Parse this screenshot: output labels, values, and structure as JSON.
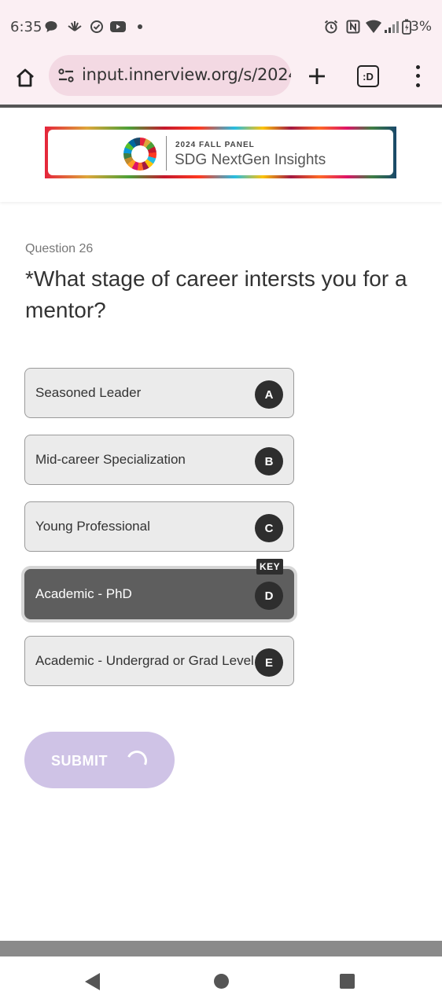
{
  "status_bar": {
    "time": "6:35",
    "battery": "3%",
    "icons": [
      "chat-icon",
      "pinwheel-icon",
      "check-circle-icon",
      "youtube-icon",
      "dot-icon",
      "alarm-icon",
      "nfc-icon",
      "wifi-icon",
      "signal-icon",
      "battery-icon"
    ]
  },
  "browser": {
    "url": "input.innerview.org/s/2024-",
    "tab_count": ":D"
  },
  "header": {
    "banner_small": "2024 FALL PANEL",
    "banner_big": "SDG NextGen Insights"
  },
  "question": {
    "number": "Question 26",
    "title": "*What stage of career intersts you for a mentor?"
  },
  "options": [
    {
      "label": "Seasoned Leader",
      "key": "A"
    },
    {
      "label": "Mid-career Specialization",
      "key": "B"
    },
    {
      "label": "Young Professional",
      "key": "C"
    },
    {
      "label": "Academic - PhD",
      "key": "D"
    },
    {
      "label": "Academic - Undergrad or Grad Level",
      "key": "E"
    }
  ],
  "selected_option": "Academic - PhD",
  "key_hint": "KEY",
  "submit": {
    "label": "SUBMIT"
  },
  "colors": {
    "status_bg": "#fbeff3",
    "url_bg": "#f3d9e3",
    "option_bg": "#ebebeb",
    "selected_bg": "#5e5e5e",
    "submit_bg": "#cfc3e6"
  }
}
